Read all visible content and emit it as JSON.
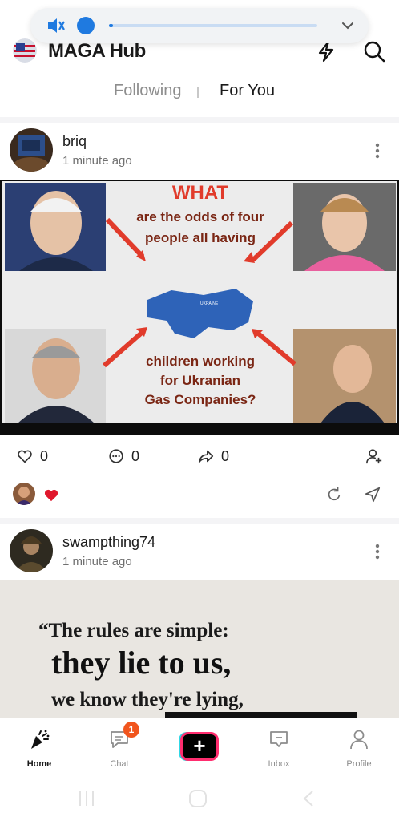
{
  "volume": {
    "level": 0.02,
    "accent": "#1f7ae0"
  },
  "header": {
    "title": "MAGA Hub"
  },
  "tabs": [
    {
      "label": "Following"
    },
    {
      "label": "For You"
    }
  ],
  "posts": [
    {
      "username": "briq",
      "time": "1 minute ago",
      "image_text": {
        "headline": "WHAT",
        "top": [
          "are the odds of four",
          "people all having"
        ],
        "bottom": [
          "children working",
          "for Ukranian",
          "Gas Companies?"
        ],
        "map_label": "UKRAINE"
      },
      "counts": {
        "likes": "0",
        "comments": "0",
        "shares": "0"
      }
    },
    {
      "username": "swampthing74",
      "time": "1 minute ago",
      "image_text": {
        "line1": "“The rules are simple:",
        "line2": "they lie to us,",
        "line3": "we know they're lying,"
      }
    }
  ],
  "nav": {
    "items": [
      {
        "label": "Home"
      },
      {
        "label": "Chat",
        "badge": "1"
      },
      {
        "label": "Inbox"
      },
      {
        "label": "Profile"
      }
    ],
    "create": "+"
  },
  "colors": {
    "badge": "#f1551d",
    "heart": "#e0182d",
    "create_border": "#ff2d6f"
  }
}
